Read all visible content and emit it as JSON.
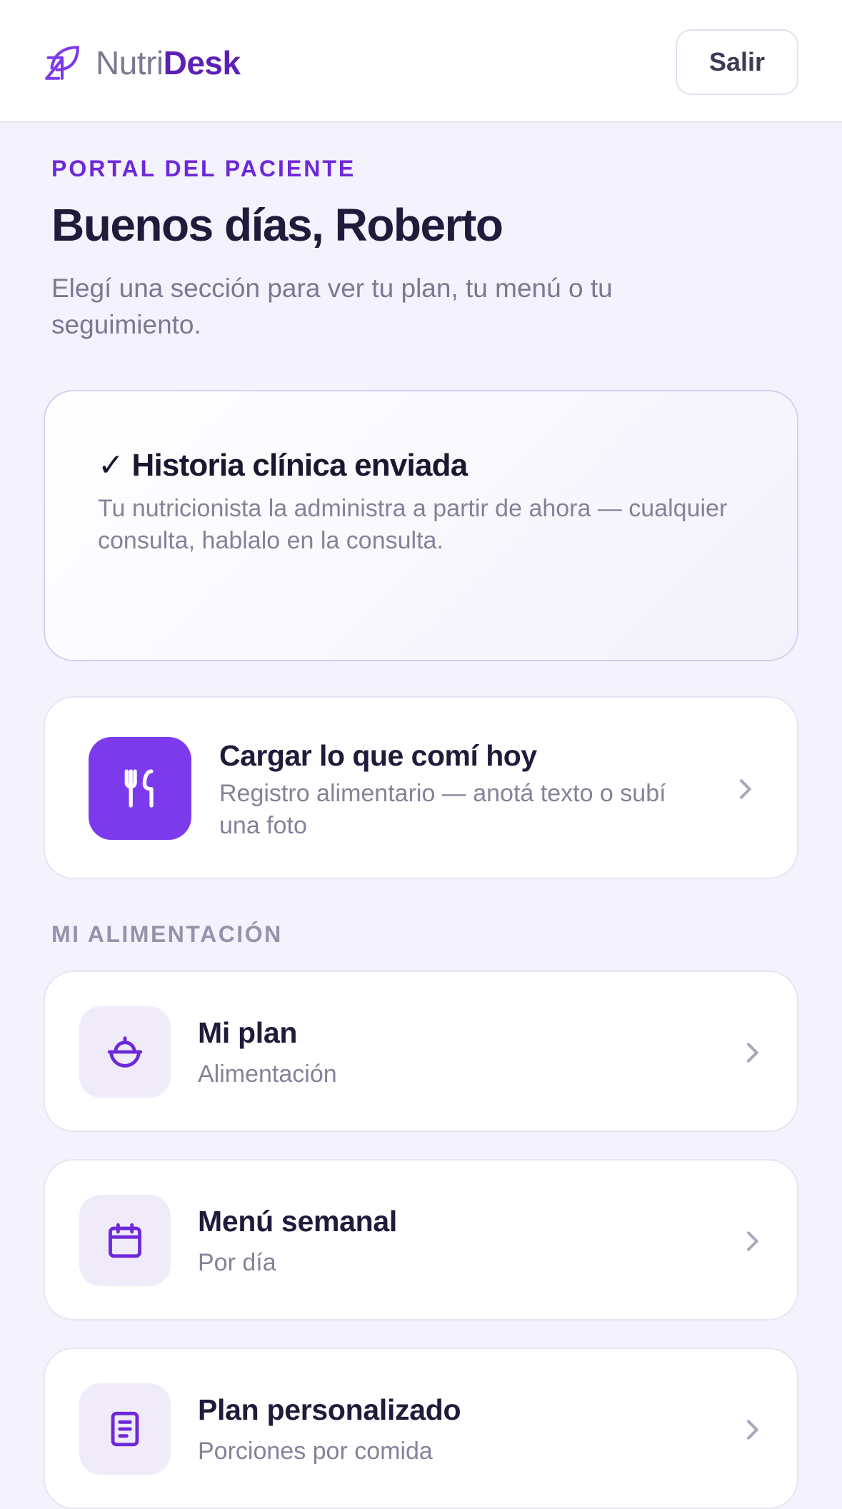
{
  "header": {
    "brand_light": "Nutri",
    "brand_bold": "Desk",
    "brand_icon": "leaf-logo-icon",
    "exit_label": "Salir"
  },
  "hero": {
    "eyebrow": "PORTAL DEL PACIENTE",
    "greeting": "Buenos días, Roberto",
    "subtitle": "Elegí una sección para ver tu plan, tu menú o tu seguimiento."
  },
  "notice": {
    "title": "✓ Historia clínica enviada",
    "text": "Tu nutricionista la administra a partir de ahora — cualquier consulta, hablalo en la consulta."
  },
  "log_food": {
    "icon": "fork-knife-icon",
    "title": "Cargar lo que comí hoy",
    "description": "Registro alimentario — anotá texto o subí una foto"
  },
  "section": {
    "label": "MI ALIMENTACIÓN",
    "items": [
      {
        "icon": "bowl-icon",
        "title": "Mi plan",
        "subtitle": "Alimentación"
      },
      {
        "icon": "calendar-icon",
        "title": "Menú semanal",
        "subtitle": "Por día"
      },
      {
        "icon": "document-icon",
        "title": "Plan personalizado",
        "subtitle": "Porciones por comida"
      }
    ]
  },
  "colors": {
    "accent": "#7c3aed",
    "accent_dark": "#5b21b6",
    "background": "#f4f2fc",
    "text_primary": "#1f1b3a",
    "text_muted": "#858299"
  }
}
